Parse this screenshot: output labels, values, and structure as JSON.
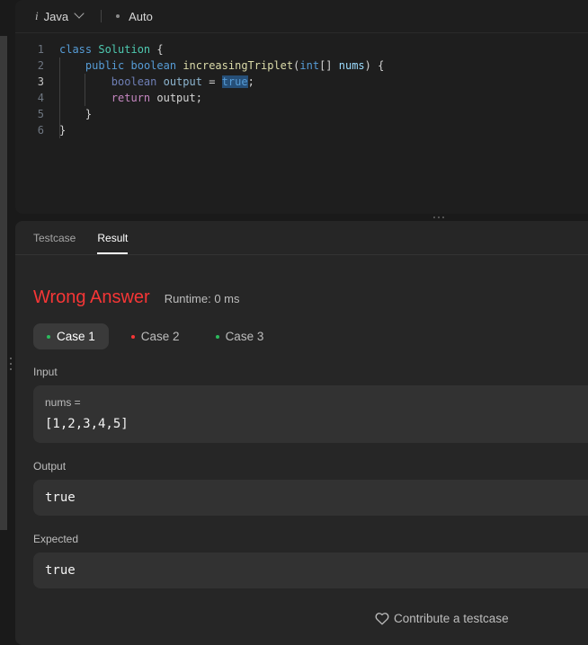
{
  "toolbar": {
    "language_icon": "i",
    "language": "Java",
    "autocomplete": "Auto"
  },
  "editor": {
    "lines": [
      {
        "n": "1"
      },
      {
        "n": "2"
      },
      {
        "n": "3"
      },
      {
        "n": "4"
      },
      {
        "n": "5"
      },
      {
        "n": "6"
      }
    ],
    "code": {
      "l1": {
        "kw": "class",
        "cls": "Solution",
        "rest": " {"
      },
      "l2": {
        "kw1": "public",
        "kw2": "boolean",
        "fn": "increasingTriplet",
        "p1": "(",
        "kw3": "int",
        "p2": "[] ",
        "var": "nums",
        "p3": ") {"
      },
      "l3": {
        "kw": "boolean",
        "var": "output",
        "eq": " = ",
        "lit": "true",
        "end": ";"
      },
      "l4": {
        "ret": "return",
        "rest": " output;"
      },
      "l5": {
        "rest": "}"
      },
      "l6": {
        "rest": "}"
      }
    }
  },
  "tabs": [
    {
      "label": "Testcase"
    },
    {
      "label": "Result"
    }
  ],
  "result": {
    "status": "Wrong Answer",
    "runtime": "Runtime: 0 ms",
    "status_color": "#f63636",
    "cases": [
      {
        "label": "Case 1",
        "dot_color": "#2cbb5d"
      },
      {
        "label": "Case 2",
        "dot_color": "#f63636"
      },
      {
        "label": "Case 3",
        "dot_color": "#2cbb5d"
      }
    ],
    "input_label": "Input",
    "input_var": "nums =",
    "input_value": "[1,2,3,4,5]",
    "output_label": "Output",
    "output_value": "true",
    "expected_label": "Expected",
    "expected_value": "true"
  },
  "contribute": {
    "label": "Contribute a testcase",
    "icon": "heart-icon"
  }
}
